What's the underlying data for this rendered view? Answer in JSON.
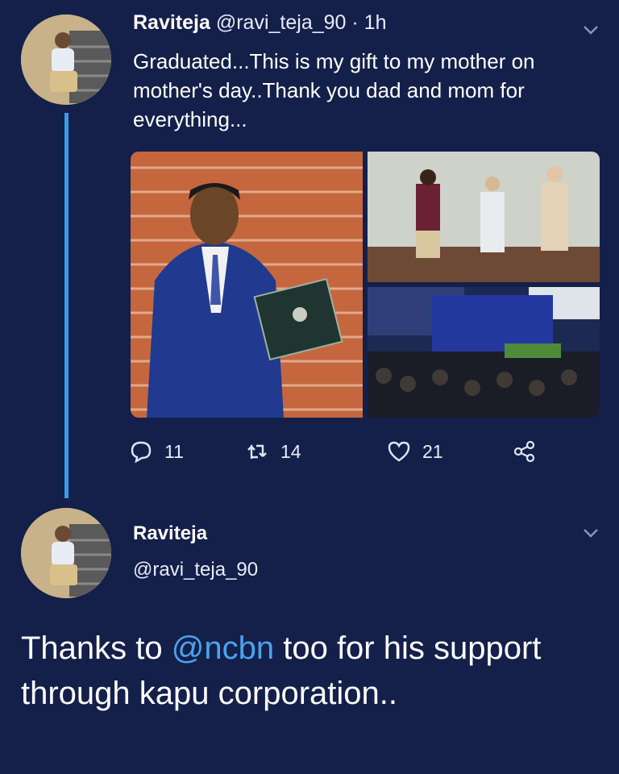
{
  "tweet": {
    "name": "Raviteja",
    "handle": "@ravi_teja_90",
    "separator": "·",
    "time": "1h",
    "text": "Graduated...This is my gift to my mother on mother's day..Thank you dad and mom for everything...",
    "counts": {
      "replies": "11",
      "retweets": "14",
      "likes": "21"
    }
  },
  "reply": {
    "name": "Raviteja",
    "handle": "@ravi_teja_90",
    "text_before": "Thanks to ",
    "mention": "@ncbn",
    "text_after": " too for his support through kapu corporation.."
  },
  "colors": {
    "background": "#14204a",
    "thread_line": "#3a9be8",
    "mention": "#4aa3f0"
  },
  "icons": [
    "reply-icon",
    "retweet-icon",
    "like-icon",
    "share-icon",
    "chevron-down-icon"
  ]
}
